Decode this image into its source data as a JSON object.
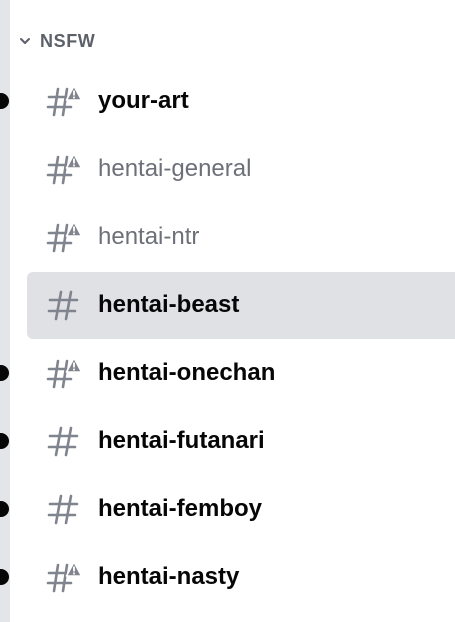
{
  "category": {
    "label": "NSFW",
    "chevron_icon": "chevron-down-icon"
  },
  "colors": {
    "text_unread": "#060607",
    "text_read": "#6d7079",
    "icon": "#80848e",
    "selected_bg": "#e0e1e5"
  },
  "channels": [
    {
      "name": "your-art",
      "icon": "nsfw-text-channel-icon",
      "unread": true,
      "selected": false
    },
    {
      "name": "hentai-general",
      "icon": "nsfw-text-channel-icon",
      "unread": false,
      "selected": false
    },
    {
      "name": "hentai-ntr",
      "icon": "nsfw-text-channel-icon",
      "unread": false,
      "selected": false
    },
    {
      "name": "hentai-beast",
      "icon": "text-channel-icon",
      "unread": false,
      "selected": true
    },
    {
      "name": "hentai-onechan",
      "icon": "nsfw-text-channel-icon",
      "unread": true,
      "selected": false
    },
    {
      "name": "hentai-futanari",
      "icon": "text-channel-icon",
      "unread": true,
      "selected": false
    },
    {
      "name": "hentai-femboy",
      "icon": "text-channel-icon",
      "unread": true,
      "selected": false
    },
    {
      "name": "hentai-nasty",
      "icon": "nsfw-text-channel-icon",
      "unread": true,
      "selected": false
    }
  ]
}
